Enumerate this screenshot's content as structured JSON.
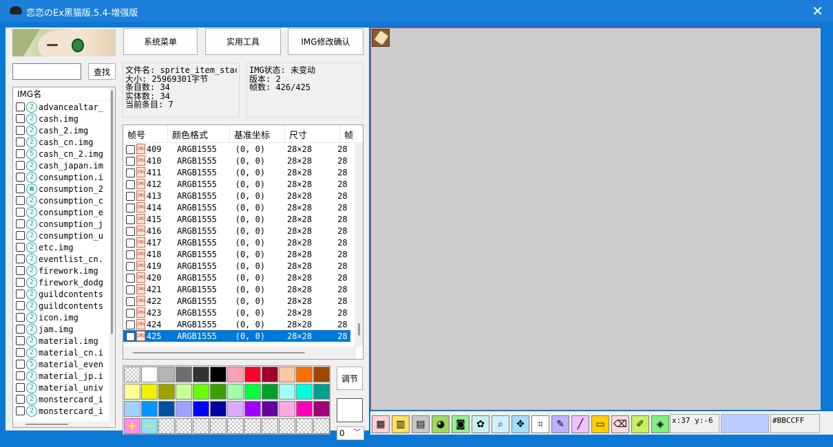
{
  "window": {
    "title": "恋恋のEx黑猫版.5.4-增强版",
    "close_glyph": "✕"
  },
  "search": {
    "value": "",
    "button_label": "查找"
  },
  "img_list": {
    "header": "IMG名",
    "items": [
      {
        "icon": "2",
        "name": "advancealtar_"
      },
      {
        "icon": "2",
        "name": "cash.img"
      },
      {
        "icon": "2",
        "name": "cash_2.img"
      },
      {
        "icon": "2",
        "name": "cash_cn.img"
      },
      {
        "icon": "5",
        "name": "cash_cn_2.img"
      },
      {
        "icon": "2",
        "name": "cash_japan.im"
      },
      {
        "icon": "2",
        "name": "consumption.i"
      },
      {
        "icon": "▦",
        "name": "consumption_2"
      },
      {
        "icon": "2",
        "name": "consumption_c"
      },
      {
        "icon": "2",
        "name": "consumption_e"
      },
      {
        "icon": "2",
        "name": "consumption_j"
      },
      {
        "icon": "2",
        "name": "consumption_u"
      },
      {
        "icon": "2",
        "name": "etc.img"
      },
      {
        "icon": "2",
        "name": "eventlist_cn."
      },
      {
        "icon": "2",
        "name": "firework.img"
      },
      {
        "icon": "2",
        "name": "firework_dodg"
      },
      {
        "icon": "2",
        "name": "guildcontents"
      },
      {
        "icon": "2",
        "name": "guildcontents"
      },
      {
        "icon": "2",
        "name": "icon.img"
      },
      {
        "icon": "2",
        "name": "jam.img"
      },
      {
        "icon": "2",
        "name": "material.img"
      },
      {
        "icon": "2",
        "name": "material_cn.i"
      },
      {
        "icon": "5",
        "name": "material_even"
      },
      {
        "icon": "2",
        "name": "material_jp.i"
      },
      {
        "icon": "2",
        "name": "material_univ"
      },
      {
        "icon": "2",
        "name": "monstercard_i"
      },
      {
        "icon": "2",
        "name": "monstercard_i"
      }
    ]
  },
  "top_buttons": {
    "system_menu": "系统菜单",
    "tools": "实用工具",
    "img_confirm": "IMG修改确认"
  },
  "file_info": {
    "line1": "文件名: sprite_item_stac",
    "line2": "大小: 25969301字节",
    "line3": "条目数: 34",
    "line4": "实体数: 34",
    "line5": "当前条目: 7"
  },
  "img_info": {
    "line1": "IMG状态: 未变动",
    "line2": "版本: 2",
    "line3": "帧数: 426/425"
  },
  "frame_table": {
    "headers": [
      "帧号",
      "颜色格式",
      "基准坐标",
      "尺寸",
      "帧"
    ],
    "rows": [
      {
        "id": "409",
        "format": "ARGB1555",
        "coord": "(0, 0)",
        "size": "28×28",
        "extra": "28"
      },
      {
        "id": "410",
        "format": "ARGB1555",
        "coord": "(0, 0)",
        "size": "28×28",
        "extra": "28"
      },
      {
        "id": "411",
        "format": "ARGB1555",
        "coord": "(0, 0)",
        "size": "28×28",
        "extra": "28"
      },
      {
        "id": "412",
        "format": "ARGB1555",
        "coord": "(0, 0)",
        "size": "28×28",
        "extra": "28"
      },
      {
        "id": "413",
        "format": "ARGB1555",
        "coord": "(0, 0)",
        "size": "28×28",
        "extra": "28"
      },
      {
        "id": "414",
        "format": "ARGB1555",
        "coord": "(0, 0)",
        "size": "28×28",
        "extra": "28"
      },
      {
        "id": "415",
        "format": "ARGB1555",
        "coord": "(0, 0)",
        "size": "28×28",
        "extra": "28"
      },
      {
        "id": "416",
        "format": "ARGB1555",
        "coord": "(0, 0)",
        "size": "28×28",
        "extra": "28"
      },
      {
        "id": "417",
        "format": "ARGB1555",
        "coord": "(0, 0)",
        "size": "28×28",
        "extra": "28"
      },
      {
        "id": "418",
        "format": "ARGB1555",
        "coord": "(0, 0)",
        "size": "28×28",
        "extra": "28"
      },
      {
        "id": "419",
        "format": "ARGB1555",
        "coord": "(0, 0)",
        "size": "28×28",
        "extra": "28"
      },
      {
        "id": "420",
        "format": "ARGB1555",
        "coord": "(0, 0)",
        "size": "28×28",
        "extra": "28"
      },
      {
        "id": "421",
        "format": "ARGB1555",
        "coord": "(0, 0)",
        "size": "28×28",
        "extra": "28"
      },
      {
        "id": "422",
        "format": "ARGB1555",
        "coord": "(0, 0)",
        "size": "28×28",
        "extra": "28"
      },
      {
        "id": "423",
        "format": "ARGB1555",
        "coord": "(0, 0)",
        "size": "28×28",
        "extra": "28"
      },
      {
        "id": "424",
        "format": "ARGB1555",
        "coord": "(0, 0)",
        "size": "28×28",
        "extra": "28"
      },
      {
        "id": "425",
        "format": "ARGB1555",
        "coord": "(0, 0)",
        "size": "28×28",
        "extra": "28",
        "selected": true
      }
    ]
  },
  "palette": {
    "colors": [
      "checker",
      "#ffffff",
      "#b4b4b4",
      "#6e6e6e",
      "#323232",
      "#000000",
      "#ffa0b4",
      "#ff0028",
      "#a00028",
      "#ffc8a0",
      "#ff6e00",
      "#a04600",
      "#ffff96",
      "#f0f000",
      "#a0a000",
      "#c8ff96",
      "#64ff00",
      "#3ca000",
      "#a0ffaa",
      "#00ff3c",
      "#00a028",
      "#a0fff0",
      "#00ffdc",
      "#00a08c",
      "#a0d2ff",
      "#0096ff",
      "#0050a0",
      "#a0a0ff",
      "#0000ff",
      "#0000a0",
      "#dcaaff",
      "#a000ff",
      "#6400a0",
      "#ffaadc",
      "#ff00b4",
      "#a00078",
      "add",
      "remove",
      "checker",
      "checker",
      "checker",
      "checker",
      "checker",
      "checker",
      "checker",
      "checker",
      "checker",
      "checker"
    ],
    "add_glyph": "+",
    "remove_glyph": "−"
  },
  "adjust": {
    "button_label": "调节",
    "select_value": "0"
  },
  "canvas": {
    "background": "#cccccc",
    "border_color": "#e0304a"
  },
  "toolbar": {
    "tools": [
      {
        "name": "grid-tool-icon",
        "glyph": "▦"
      },
      {
        "name": "palette-tool-icon",
        "glyph": "▥"
      },
      {
        "name": "film-tool-icon",
        "glyph": "▤"
      },
      {
        "name": "cat-tool-icon",
        "glyph": "◕"
      },
      {
        "name": "camera-tool-icon",
        "glyph": "◙"
      },
      {
        "name": "paw-tool-icon",
        "glyph": "✿"
      },
      {
        "name": "zoom-tool-icon",
        "glyph": "⌕"
      },
      {
        "name": "move-tool-icon",
        "glyph": "✥"
      },
      {
        "name": "crop-tool-icon",
        "glyph": "⌗"
      },
      {
        "name": "pencil-tool-icon",
        "glyph": "✎"
      },
      {
        "name": "line-tool-icon",
        "glyph": "╱"
      },
      {
        "name": "rect-tool-icon",
        "glyph": "▭"
      },
      {
        "name": "eraser-tool-icon",
        "glyph": "⌫"
      },
      {
        "name": "eyedropper-tool-icon",
        "glyph": "✐"
      },
      {
        "name": "fill-tool-icon",
        "glyph": "◈"
      }
    ],
    "coords": "x:37 y:-6",
    "current_color": "#BBCCFF",
    "color_hex": "#BBCCFF"
  }
}
